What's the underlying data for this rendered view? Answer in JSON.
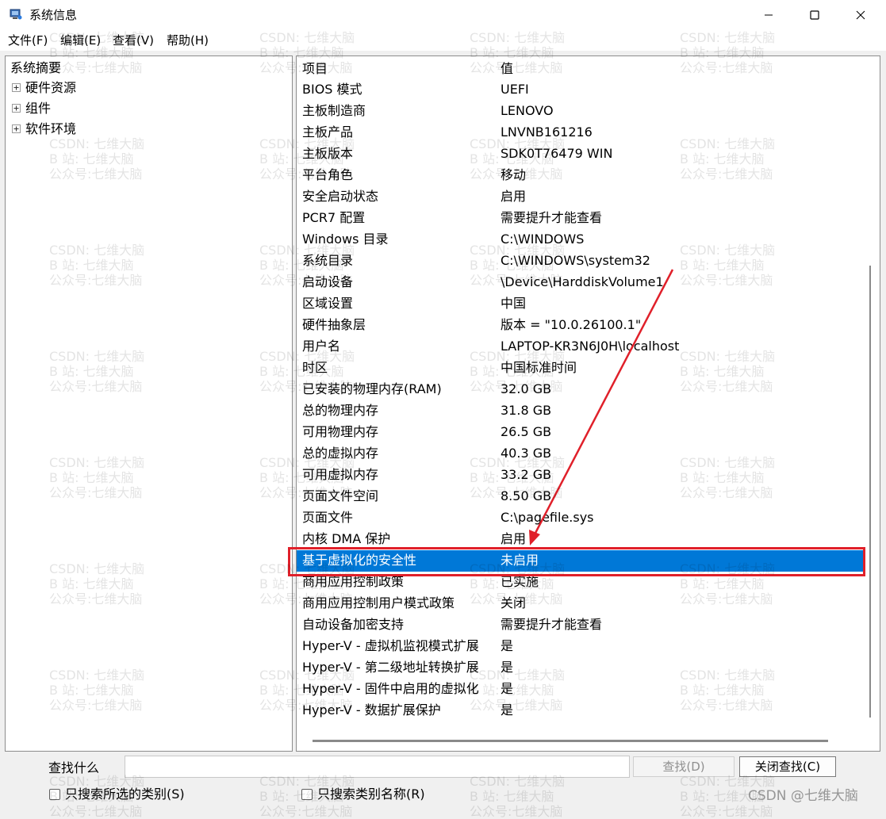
{
  "window": {
    "title": "系统信息"
  },
  "menu": [
    "文件(F)",
    "编辑(E)",
    "查看(V)",
    "帮助(H)"
  ],
  "tree": {
    "root": "系统摘要",
    "children": [
      "硬件资源",
      "组件",
      "软件环境"
    ]
  },
  "table": {
    "headers": [
      "项目",
      "值"
    ],
    "rows": [
      [
        "BIOS 模式",
        "UEFI"
      ],
      [
        "主板制造商",
        "LENOVO"
      ],
      [
        "主板产品",
        "LNVNB161216"
      ],
      [
        "主板版本",
        "SDK0T76479 WIN"
      ],
      [
        "平台角色",
        "移动"
      ],
      [
        "安全启动状态",
        "启用"
      ],
      [
        "PCR7 配置",
        "需要提升才能查看"
      ],
      [
        "Windows 目录",
        "C:\\WINDOWS"
      ],
      [
        "系统目录",
        "C:\\WINDOWS\\system32"
      ],
      [
        "启动设备",
        "\\Device\\HarddiskVolume1"
      ],
      [
        "区域设置",
        "中国"
      ],
      [
        "硬件抽象层",
        "版本 = \"10.0.26100.1\""
      ],
      [
        "用户名",
        "LAPTOP-KR3N6J0H\\localhost"
      ],
      [
        "时区",
        "中国标准时间"
      ],
      [
        "已安装的物理内存(RAM)",
        "32.0 GB"
      ],
      [
        "总的物理内存",
        "31.8 GB"
      ],
      [
        "可用物理内存",
        "26.5 GB"
      ],
      [
        "总的虚拟内存",
        "40.3 GB"
      ],
      [
        "可用虚拟内存",
        "33.2 GB"
      ],
      [
        "页面文件空间",
        "8.50 GB"
      ],
      [
        "页面文件",
        "C:\\pagefile.sys"
      ],
      [
        "内核 DMA 保护",
        "启用"
      ],
      [
        "基于虚拟化的安全性",
        "未启用"
      ],
      [
        "商用应用控制政策",
        "已实施"
      ],
      [
        "商用应用控制用户模式政策",
        "关闭"
      ],
      [
        "自动设备加密支持",
        "需要提升才能查看"
      ],
      [
        "Hyper-V - 虚拟机监视模式扩展",
        "是"
      ],
      [
        "Hyper-V - 第二级地址转换扩展",
        "是"
      ],
      [
        "Hyper-V - 固件中启用的虚拟化",
        "是"
      ],
      [
        "Hyper-V - 数据扩展保护",
        "是"
      ]
    ],
    "selected_index": 22
  },
  "find": {
    "label": "查找什么",
    "value": "",
    "find_button": "查找(D)",
    "close_button": "关闭查找(C)",
    "checkbox1": "只搜索所选的类别(S)",
    "checkbox2": "只搜索类别名称(R)"
  },
  "watermark": "CSDN: 七维大脑\nB 站: 七维大脑\n公众号:七维大脑",
  "corner_watermark": "CSDN @七维大脑",
  "colors": {
    "selection": "#0078d7",
    "annotation": "#e0202a"
  }
}
